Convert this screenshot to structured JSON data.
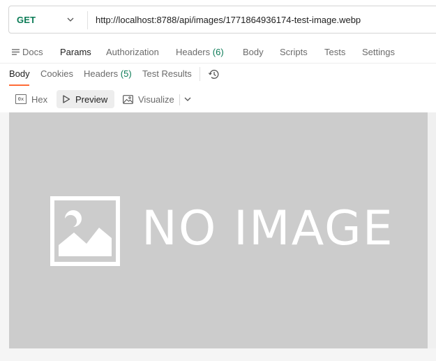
{
  "request": {
    "method": "GET",
    "url": "http://localhost:8788/api/images/1771864936174-test-image.webp"
  },
  "request_tabs": {
    "docs": "Docs",
    "params": "Params",
    "authorization": "Authorization",
    "headers": "Headers",
    "headers_count": "(6)",
    "body": "Body",
    "scripts": "Scripts",
    "tests": "Tests",
    "settings": "Settings"
  },
  "response_tabs": {
    "body": "Body",
    "cookies": "Cookies",
    "headers": "Headers",
    "headers_count": "(5)",
    "test_results": "Test Results"
  },
  "view_modes": {
    "hex": "Hex",
    "hex_icon_text": "0x",
    "preview": "Preview",
    "visualize": "Visualize"
  },
  "preview": {
    "placeholder_text": "NO IMAGE"
  },
  "colors": {
    "method_get": "#0b7b56",
    "accent_underline": "#ff6c37",
    "count_green": "#0b7b56",
    "placeholder_bg": "#cccccc"
  }
}
